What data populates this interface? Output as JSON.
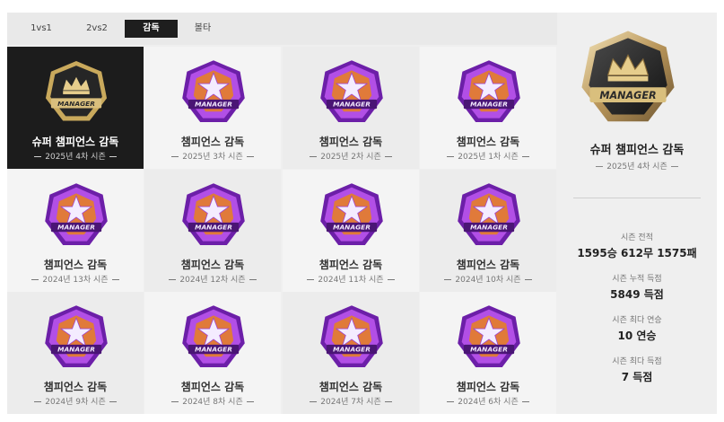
{
  "tabs": [
    {
      "label": "1vs1",
      "active": false
    },
    {
      "label": "2vs2",
      "active": false
    },
    {
      "label": "감독",
      "active": true
    },
    {
      "label": "볼타",
      "active": false
    }
  ],
  "badges": [
    {
      "title": "슈퍼 챔피언스 감독",
      "season": "2025년 4차 시즌",
      "tier": "gold",
      "selected": true
    },
    {
      "title": "챔피언스 감독",
      "season": "2025년 3차 시즌",
      "tier": "purple",
      "selected": false
    },
    {
      "title": "챔피언스 감독",
      "season": "2025년 2차 시즌",
      "tier": "purple",
      "selected": false
    },
    {
      "title": "챔피언스 감독",
      "season": "2025년 1차 시즌",
      "tier": "purple",
      "selected": false
    },
    {
      "title": "챔피언스 감독",
      "season": "2024년 13차 시즌",
      "tier": "purple",
      "selected": false
    },
    {
      "title": "챔피언스 감독",
      "season": "2024년 12차 시즌",
      "tier": "purple",
      "selected": false
    },
    {
      "title": "챔피언스 감독",
      "season": "2024년 11차 시즌",
      "tier": "purple",
      "selected": false
    },
    {
      "title": "챔피언스 감독",
      "season": "2024년 10차 시즌",
      "tier": "purple",
      "selected": false
    },
    {
      "title": "챔피언스 감독",
      "season": "2024년 9차 시즌",
      "tier": "purple",
      "selected": false
    },
    {
      "title": "챔피언스 감독",
      "season": "2024년 8차 시즌",
      "tier": "purple",
      "selected": false
    },
    {
      "title": "챔피언스 감독",
      "season": "2024년 7차 시즌",
      "tier": "purple",
      "selected": false
    },
    {
      "title": "챔피언스 감독",
      "season": "2024년 6차 시즌",
      "tier": "purple",
      "selected": false
    }
  ],
  "badge_text": "MANAGER",
  "detail": {
    "title": "슈퍼 챔피언스 감독",
    "season": "2025년 4차 시즌",
    "stats": [
      {
        "label": "시즌 전적",
        "value": "1595승 612무 1575패"
      },
      {
        "label": "시즌 누적 득점",
        "value": "5849 득점"
      },
      {
        "label": "시즌 최다 연승",
        "value": "10 연승"
      },
      {
        "label": "시즌 최다 득점",
        "value": "7 득점"
      }
    ]
  },
  "colors": {
    "selected_bg": "#1c1c1c",
    "purple": "#8a2ad0",
    "purple_light": "#d58cf5",
    "gold": "#c9a95c",
    "gold_dark": "#2a2a2a"
  }
}
